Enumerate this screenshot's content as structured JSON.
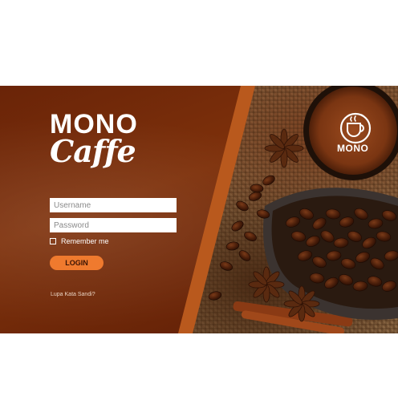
{
  "brand": {
    "name_top": "MONO",
    "name_bottom": "Caffe"
  },
  "login_form": {
    "username_placeholder": "Username",
    "password_placeholder": "Password",
    "remember_label": "Remember me",
    "remember_checked": false,
    "login_label": "LOGIN",
    "forgot_label": "Lupa Kata Sandi?"
  },
  "photo_logo": {
    "text": "MONO",
    "icon": "coffee-cup-icon"
  },
  "colors": {
    "panel_brown": "#7e310b",
    "accent_orange": "#ef7a2e",
    "stripe_orange": "#b9591d"
  }
}
